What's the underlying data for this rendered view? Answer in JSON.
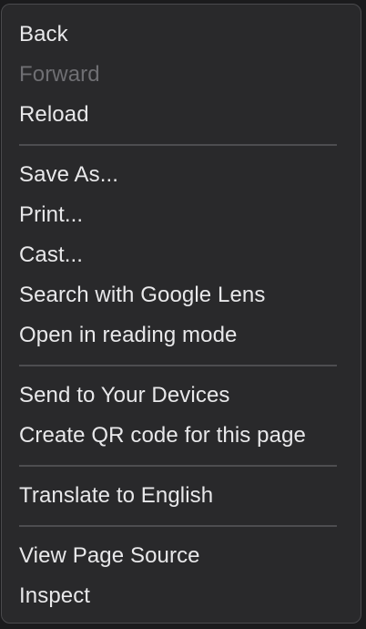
{
  "menu": {
    "groups": [
      {
        "items": [
          {
            "label": "Back",
            "enabled": true
          },
          {
            "label": "Forward",
            "enabled": false
          },
          {
            "label": "Reload",
            "enabled": true
          }
        ]
      },
      {
        "items": [
          {
            "label": "Save As...",
            "enabled": true
          },
          {
            "label": "Print...",
            "enabled": true
          },
          {
            "label": "Cast...",
            "enabled": true
          },
          {
            "label": "Search with Google Lens",
            "enabled": true
          },
          {
            "label": "Open in reading mode",
            "enabled": true
          }
        ]
      },
      {
        "items": [
          {
            "label": "Send to Your Devices",
            "enabled": true
          },
          {
            "label": "Create QR code for this page",
            "enabled": true
          }
        ]
      },
      {
        "items": [
          {
            "label": "Translate to English",
            "enabled": true
          }
        ]
      },
      {
        "items": [
          {
            "label": "View Page Source",
            "enabled": true
          },
          {
            "label": "Inspect",
            "enabled": true
          }
        ]
      }
    ]
  },
  "colors": {
    "menu_background": "#29292b",
    "text": "#e8e8ea",
    "disabled_text": "#6f6f73",
    "separator": "#4d4d50"
  }
}
